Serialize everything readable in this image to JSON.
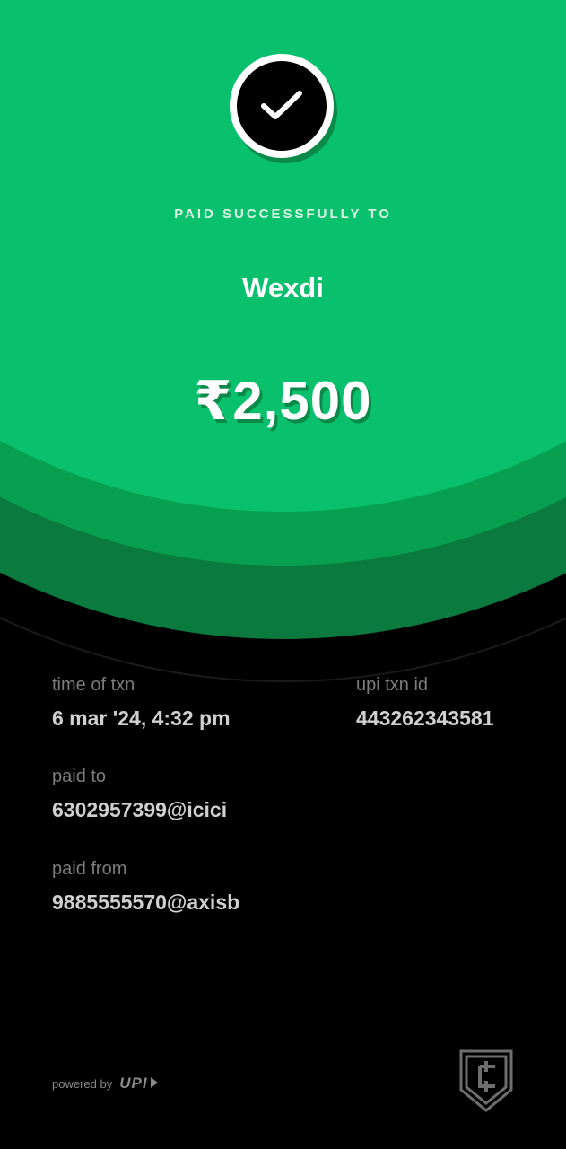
{
  "hero": {
    "status_label": "PAID SUCCESSFULLY TO",
    "payee_name": "Wexdi",
    "amount": "₹2,500"
  },
  "details": {
    "time_label": "time of txn",
    "time_value": "6 mar '24, 4:32 pm",
    "txn_id_label": "upi txn id",
    "txn_id_value": "443262343581",
    "paid_to_label": "paid to",
    "paid_to_value": "6302957399@icici",
    "paid_from_label": "paid from",
    "paid_from_value": "9885555570@axisb"
  },
  "footer": {
    "powered_by": "powered by",
    "upi_text": "UPI"
  },
  "colors": {
    "accent_green": "#09c16d",
    "dark_green": "#0a7a3f",
    "background": "#000000"
  },
  "icons": {
    "badge": "check-icon",
    "brand": "cred-shield-logo-icon"
  }
}
